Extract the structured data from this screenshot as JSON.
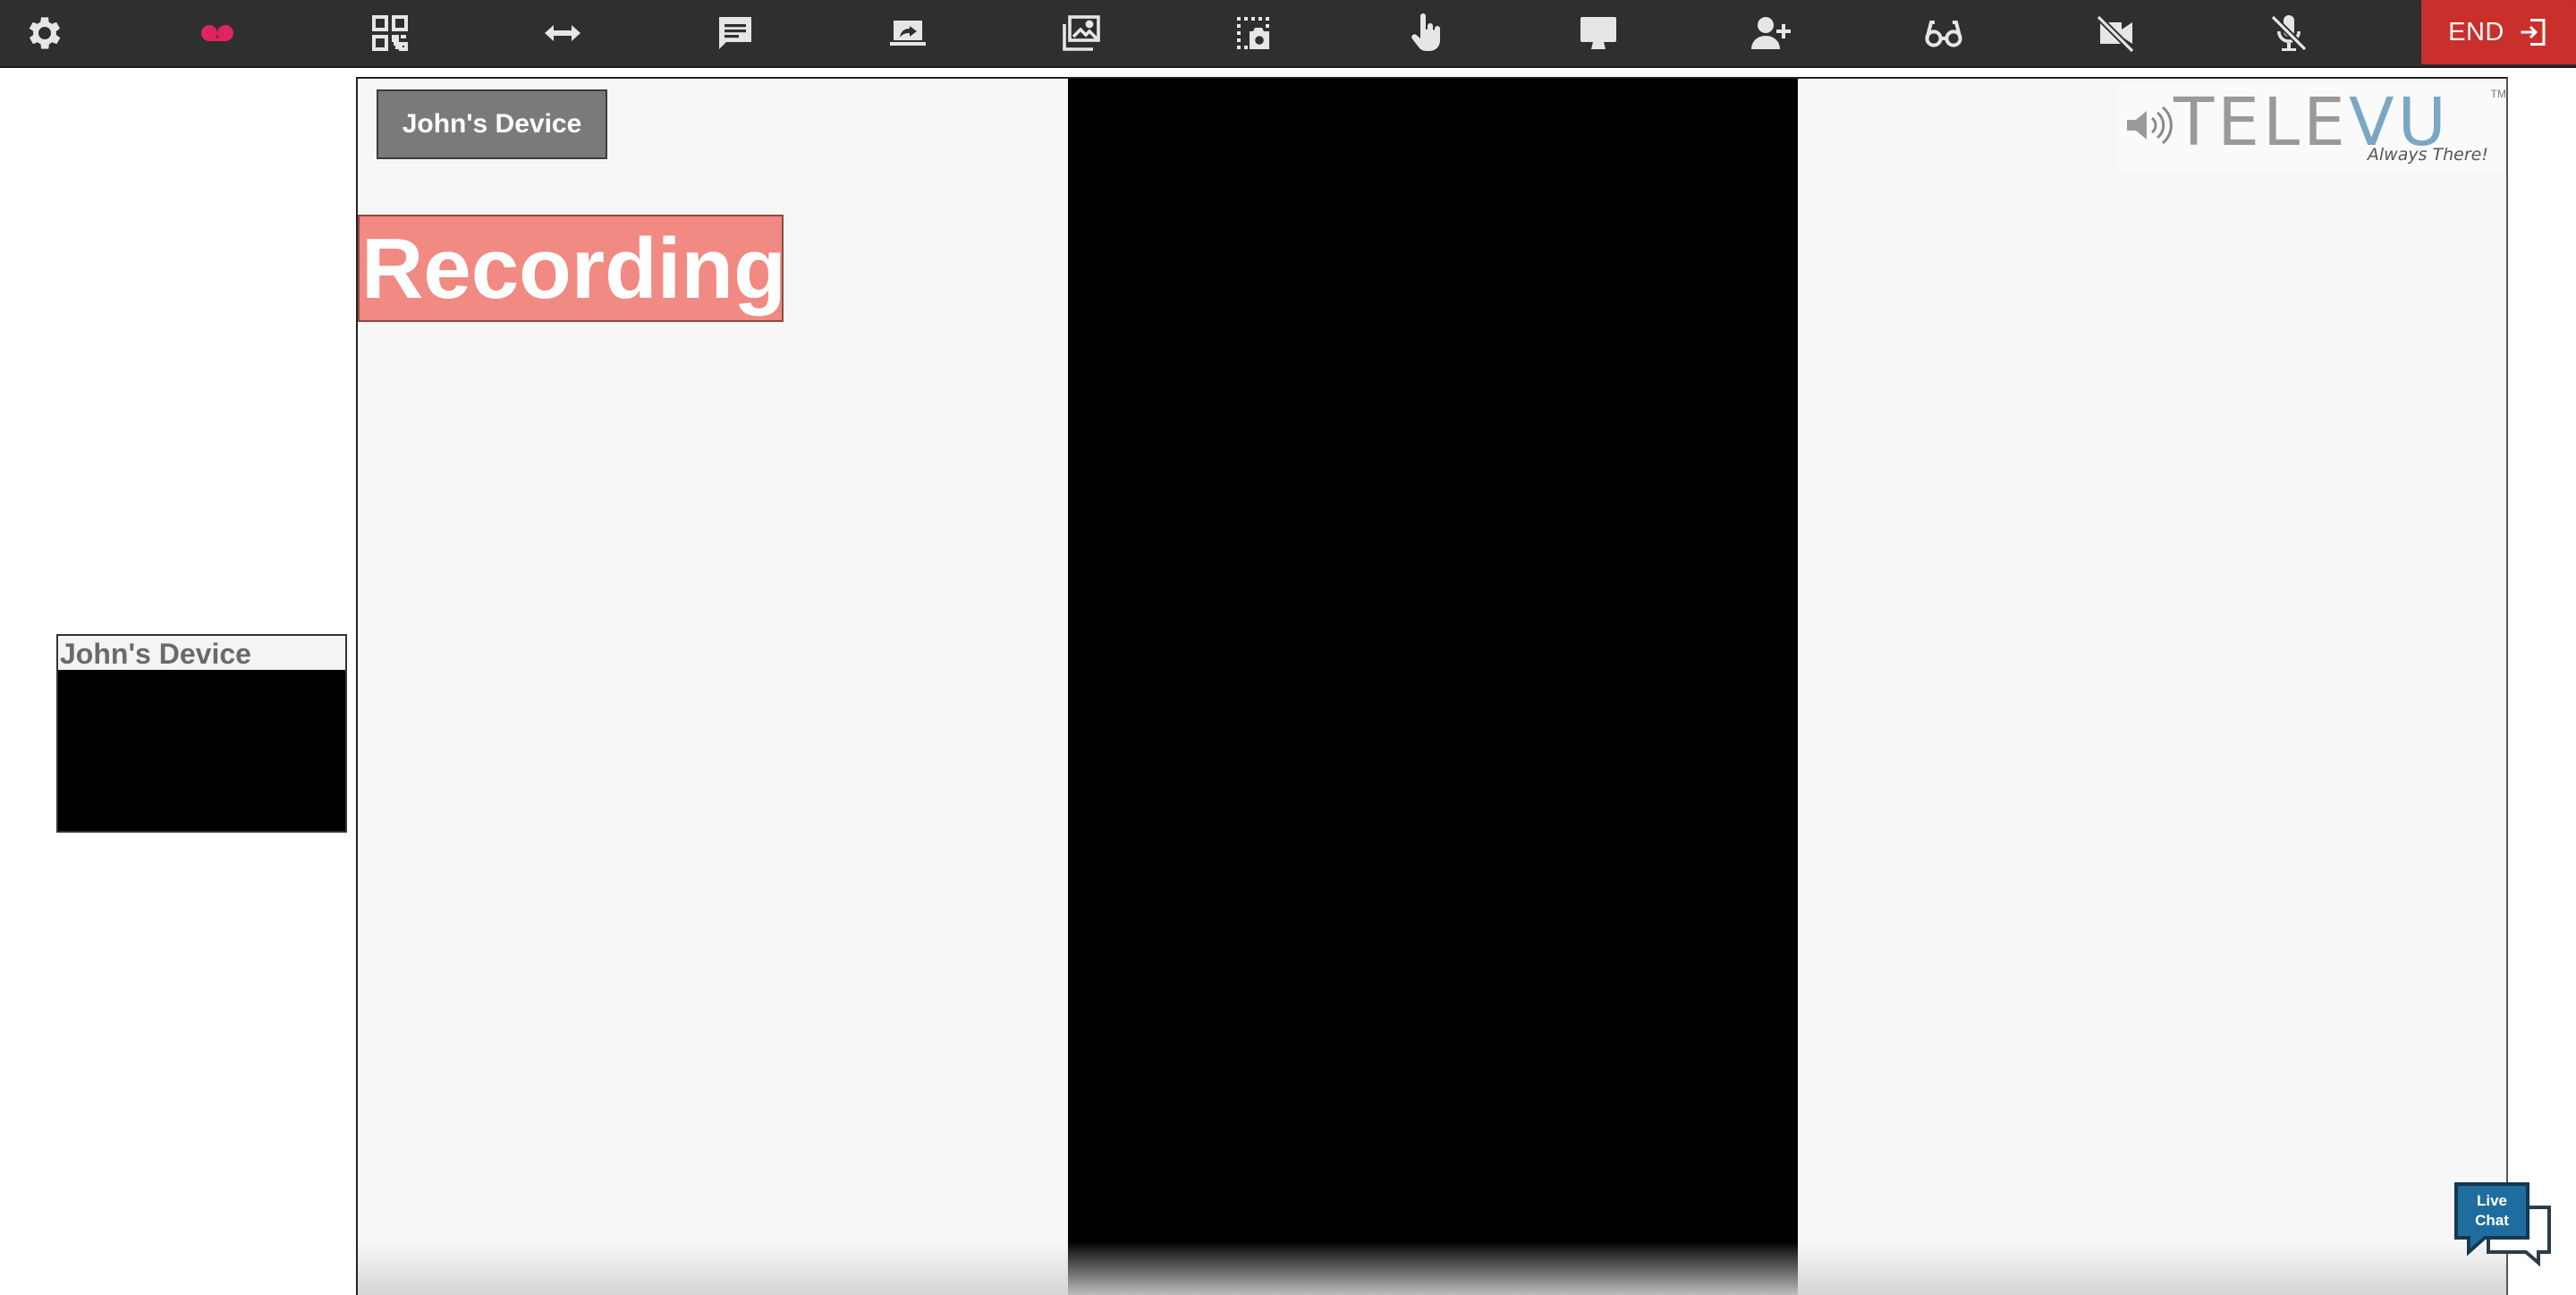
{
  "toolbar": {
    "buttons": [
      {
        "id": "settings",
        "icon": "gear-icon"
      },
      {
        "id": "record",
        "icon": "record-icon",
        "color": "#e0245e"
      },
      {
        "id": "qr",
        "icon": "qr-code-icon"
      },
      {
        "id": "resize",
        "icon": "double-arrow-icon"
      },
      {
        "id": "chat",
        "icon": "chat-bubble-icon"
      },
      {
        "id": "share",
        "icon": "share-screen-icon"
      },
      {
        "id": "gallery",
        "icon": "gallery-icon"
      },
      {
        "id": "snapshot",
        "icon": "snapshot-icon"
      },
      {
        "id": "pointer",
        "icon": "hand-pointer-icon"
      },
      {
        "id": "display",
        "icon": "monitor-icon"
      },
      {
        "id": "add-user",
        "icon": "add-user-icon"
      },
      {
        "id": "glasses",
        "icon": "glasses-icon"
      },
      {
        "id": "video-off",
        "icon": "video-off-icon"
      },
      {
        "id": "mic-off",
        "icon": "mic-off-icon"
      }
    ],
    "end_label": "END"
  },
  "stage": {
    "device_label": "John's Device",
    "recording_label": "Recording"
  },
  "logo": {
    "brand_gray": "TELE",
    "brand_blue": "VU",
    "tagline": "Always There!",
    "trademark": "TM"
  },
  "thumbnail": {
    "name": "John's Device"
  },
  "livechat": {
    "line1": "Live",
    "line2": "Chat"
  },
  "colors": {
    "toolbar_bg": "#2f2f2f",
    "end_button": "#c9302c",
    "recording_bg": "#f08a82",
    "brand_blue": "#7ba7c4"
  }
}
